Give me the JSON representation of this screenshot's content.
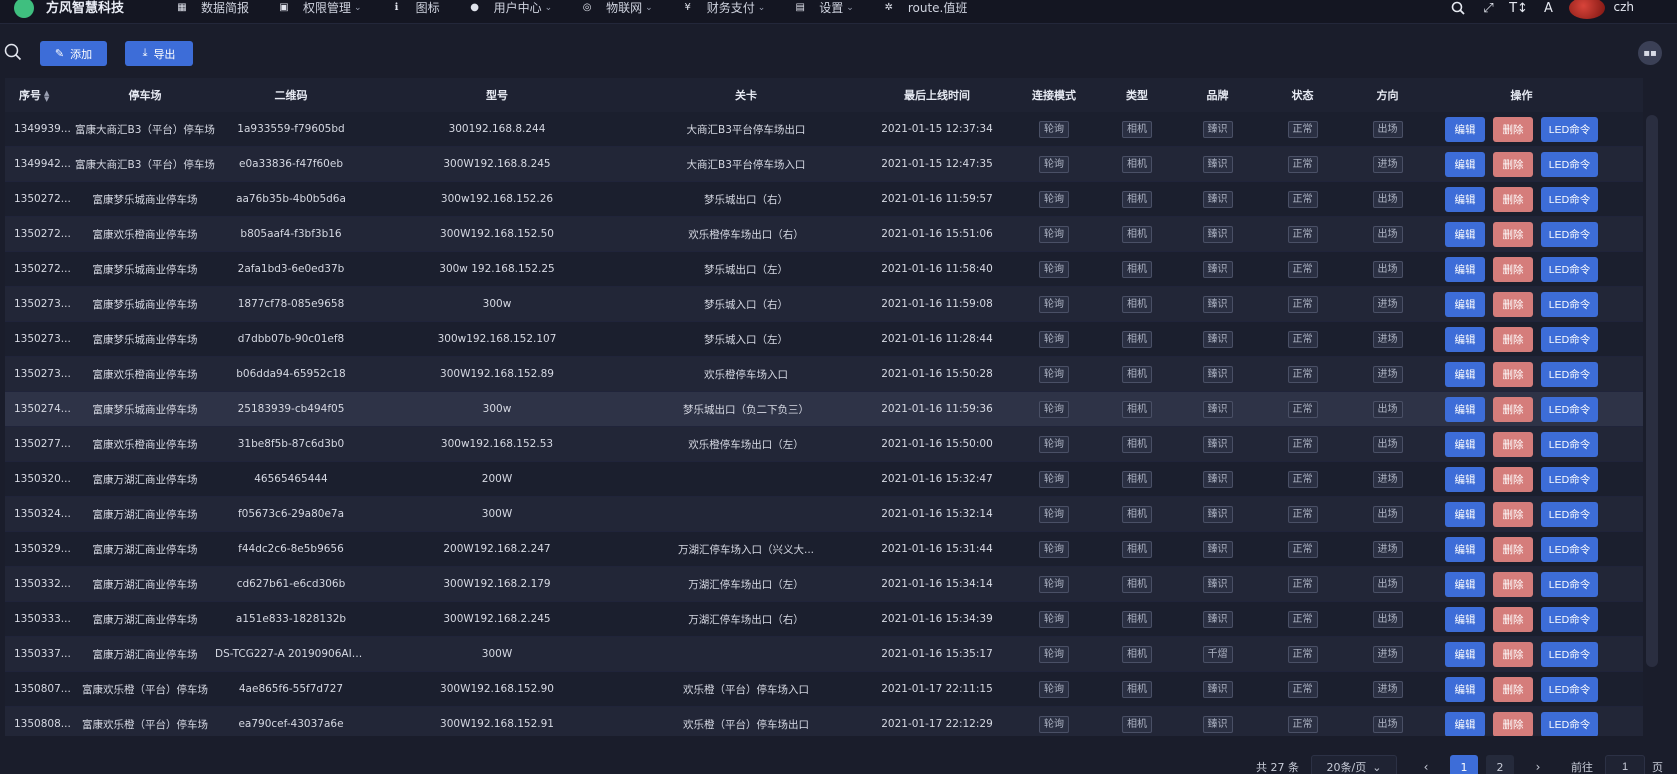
{
  "app": {
    "title": "方风智慧科技",
    "brand_color": "#3d6dd8"
  },
  "nav": [
    {
      "icon": "dashboard-icon",
      "glyph": "▦",
      "label": "数据简报",
      "has_menu": false
    },
    {
      "icon": "briefcase-icon",
      "glyph": "▣",
      "label": "权限管理",
      "has_menu": true
    },
    {
      "icon": "info-icon",
      "glyph": "ℹ",
      "label": "图标",
      "has_menu": false
    },
    {
      "icon": "user-icon",
      "glyph": "●",
      "label": "用户中心",
      "has_menu": true
    },
    {
      "icon": "network-icon",
      "glyph": "◎",
      "label": "物联网",
      "has_menu": true
    },
    {
      "icon": "yen-icon",
      "glyph": "¥",
      "label": "财务支付",
      "has_menu": true
    },
    {
      "icon": "lock-icon",
      "glyph": "▤",
      "label": "设置",
      "has_menu": true
    },
    {
      "icon": "gear-icon",
      "glyph": "✲",
      "label": "route.值班",
      "has_menu": false
    }
  ],
  "user": {
    "name": "czh"
  },
  "toolbar": {
    "add_label": "添加",
    "export_label": "导出"
  },
  "table": {
    "headers": [
      "序号",
      "停车场",
      "二维码",
      "型号",
      "关卡",
      "最后上线时间",
      "连接模式",
      "类型",
      "品牌",
      "状态",
      "方向",
      "操作"
    ],
    "action_labels": {
      "edit": "编辑",
      "delete": "删除",
      "led": "LED命令"
    },
    "rows": [
      {
        "id": "1349939...",
        "park": "富康大商汇B3（平台）停车场",
        "qr": "1a933559-f79605bd",
        "model": "300192.168.8.244",
        "gate": "大商汇B3平台停车场出口",
        "time": "2021-01-15 12:37:34",
        "conn": "轮询",
        "type": "相机",
        "brand": "臻识",
        "status": "正常",
        "dir": "出场"
      },
      {
        "id": "1349942...",
        "park": "富康大商汇B3（平台）停车场",
        "qr": "e0a33836-f47f60eb",
        "model": "300W192.168.8.245",
        "gate": "大商汇B3平台停车场入口",
        "time": "2021-01-15 12:47:35",
        "conn": "轮询",
        "type": "相机",
        "brand": "臻识",
        "status": "正常",
        "dir": "进场"
      },
      {
        "id": "1350272...",
        "park": "富康梦乐城商业停车场",
        "qr": "aa76b35b-4b0b5d6a",
        "model": "300w192.168.152.26",
        "gate": "梦乐城出口（右）",
        "time": "2021-01-16 11:59:57",
        "conn": "轮询",
        "type": "相机",
        "brand": "臻识",
        "status": "正常",
        "dir": "出场"
      },
      {
        "id": "1350272...",
        "park": "富康欢乐橙商业停车场",
        "qr": "b805aaf4-f3bf3b16",
        "model": "300W192.168.152.50",
        "gate": "欢乐橙停车场出口（右）",
        "time": "2021-01-16 15:51:06",
        "conn": "轮询",
        "type": "相机",
        "brand": "臻识",
        "status": "正常",
        "dir": "出场"
      },
      {
        "id": "1350272...",
        "park": "富康梦乐城商业停车场",
        "qr": "2afa1bd3-6e0ed37b",
        "model": "300w 192.168.152.25",
        "gate": "梦乐城出口（左）",
        "time": "2021-01-16 11:58:40",
        "conn": "轮询",
        "type": "相机",
        "brand": "臻识",
        "status": "正常",
        "dir": "出场"
      },
      {
        "id": "1350273...",
        "park": "富康梦乐城商业停车场",
        "qr": "1877cf78-085e9658",
        "model": "300w",
        "gate": "梦乐城入口（右）",
        "time": "2021-01-16 11:59:08",
        "conn": "轮询",
        "type": "相机",
        "brand": "臻识",
        "status": "正常",
        "dir": "进场"
      },
      {
        "id": "1350273...",
        "park": "富康梦乐城商业停车场",
        "qr": "d7dbb07b-90c01ef8",
        "model": "300w192.168.152.107",
        "gate": "梦乐城入口（左）",
        "time": "2021-01-16 11:28:44",
        "conn": "轮询",
        "type": "相机",
        "brand": "臻识",
        "status": "正常",
        "dir": "进场"
      },
      {
        "id": "1350273...",
        "park": "富康欢乐橙商业停车场",
        "qr": "b06dda94-65952c18",
        "model": "300W192.168.152.89",
        "gate": "欢乐橙停车场入口",
        "time": "2021-01-16 15:50:28",
        "conn": "轮询",
        "type": "相机",
        "brand": "臻识",
        "status": "正常",
        "dir": "进场"
      },
      {
        "id": "1350274...",
        "park": "富康梦乐城商业停车场",
        "qr": "25183939-cb494f05",
        "model": "300w",
        "gate": "梦乐城出口（负二下负三）",
        "time": "2021-01-16 11:59:36",
        "conn": "轮询",
        "type": "相机",
        "brand": "臻识",
        "status": "正常",
        "dir": "出场"
      },
      {
        "id": "1350277...",
        "park": "富康欢乐橙商业停车场",
        "qr": "31be8f5b-87c6d3b0",
        "model": "300w192.168.152.53",
        "gate": "欢乐橙停车场出口（左）",
        "time": "2021-01-16 15:50:00",
        "conn": "轮询",
        "type": "相机",
        "brand": "臻识",
        "status": "正常",
        "dir": "出场"
      },
      {
        "id": "1350320...",
        "park": "富康万湖汇商业停车场",
        "qr": "46565465444",
        "model": "200W",
        "gate": "",
        "time": "2021-01-16 15:32:47",
        "conn": "轮询",
        "type": "相机",
        "brand": "臻识",
        "status": "正常",
        "dir": "进场"
      },
      {
        "id": "1350324...",
        "park": "富康万湖汇商业停车场",
        "qr": "f05673c6-29a80e7a",
        "model": "300W",
        "gate": "",
        "time": "2021-01-16 15:32:14",
        "conn": "轮询",
        "type": "相机",
        "brand": "臻识",
        "status": "正常",
        "dir": "出场"
      },
      {
        "id": "1350329...",
        "park": "富康万湖汇商业停车场",
        "qr": "f44dc2c6-8e5b9656",
        "model": "200W192.168.2.247",
        "gate": "万湖汇停车场入口（兴义大...",
        "time": "2021-01-16 15:31:44",
        "conn": "轮询",
        "type": "相机",
        "brand": "臻识",
        "status": "正常",
        "dir": "进场"
      },
      {
        "id": "1350332...",
        "park": "富康万湖汇商业停车场",
        "qr": "cd627b61-e6cd306b",
        "model": "300W192.168.2.179",
        "gate": "万湖汇停车场出口（左）",
        "time": "2021-01-16 15:34:14",
        "conn": "轮询",
        "type": "相机",
        "brand": "臻识",
        "status": "正常",
        "dir": "出场"
      },
      {
        "id": "1350333...",
        "park": "富康万湖汇商业停车场",
        "qr": "a151e833-1828132b",
        "model": "300W192.168.2.245",
        "gate": "万湖汇停车场出口（右）",
        "time": "2021-01-16 15:34:39",
        "conn": "轮询",
        "type": "相机",
        "brand": "臻识",
        "status": "正常",
        "dir": "出场"
      },
      {
        "id": "1350337...",
        "park": "富康万湖汇商业停车场",
        "qr": "DS-TCG227-A 20190906AID...",
        "model": "300W",
        "gate": "",
        "time": "2021-01-16 15:35:17",
        "conn": "轮询",
        "type": "相机",
        "brand": "千熠",
        "status": "正常",
        "dir": "进场"
      },
      {
        "id": "1350807...",
        "park": "富康欢乐橙（平台）停车场",
        "qr": "4ae865f6-55f7d727",
        "model": "300W192.168.152.90",
        "gate": "欢乐橙（平台）停车场入口",
        "time": "2021-01-17 22:11:15",
        "conn": "轮询",
        "type": "相机",
        "brand": "臻识",
        "status": "正常",
        "dir": "进场"
      },
      {
        "id": "1350808...",
        "park": "富康欢乐橙（平台）停车场",
        "qr": "ea790cef-43037a6e",
        "model": "300W192.168.152.91",
        "gate": "欢乐橙（平台）停车场出口",
        "time": "2021-01-17 22:12:29",
        "conn": "轮询",
        "type": "相机",
        "brand": "臻识",
        "status": "正常",
        "dir": "出场"
      }
    ],
    "highlighted_row": 8
  },
  "pagination": {
    "total_text": "共 27 条",
    "page_size": "20条/页",
    "pages": [
      "1",
      "2"
    ],
    "current": "1",
    "goto_label": "前往",
    "goto_value": "1",
    "page_suffix": "页"
  }
}
